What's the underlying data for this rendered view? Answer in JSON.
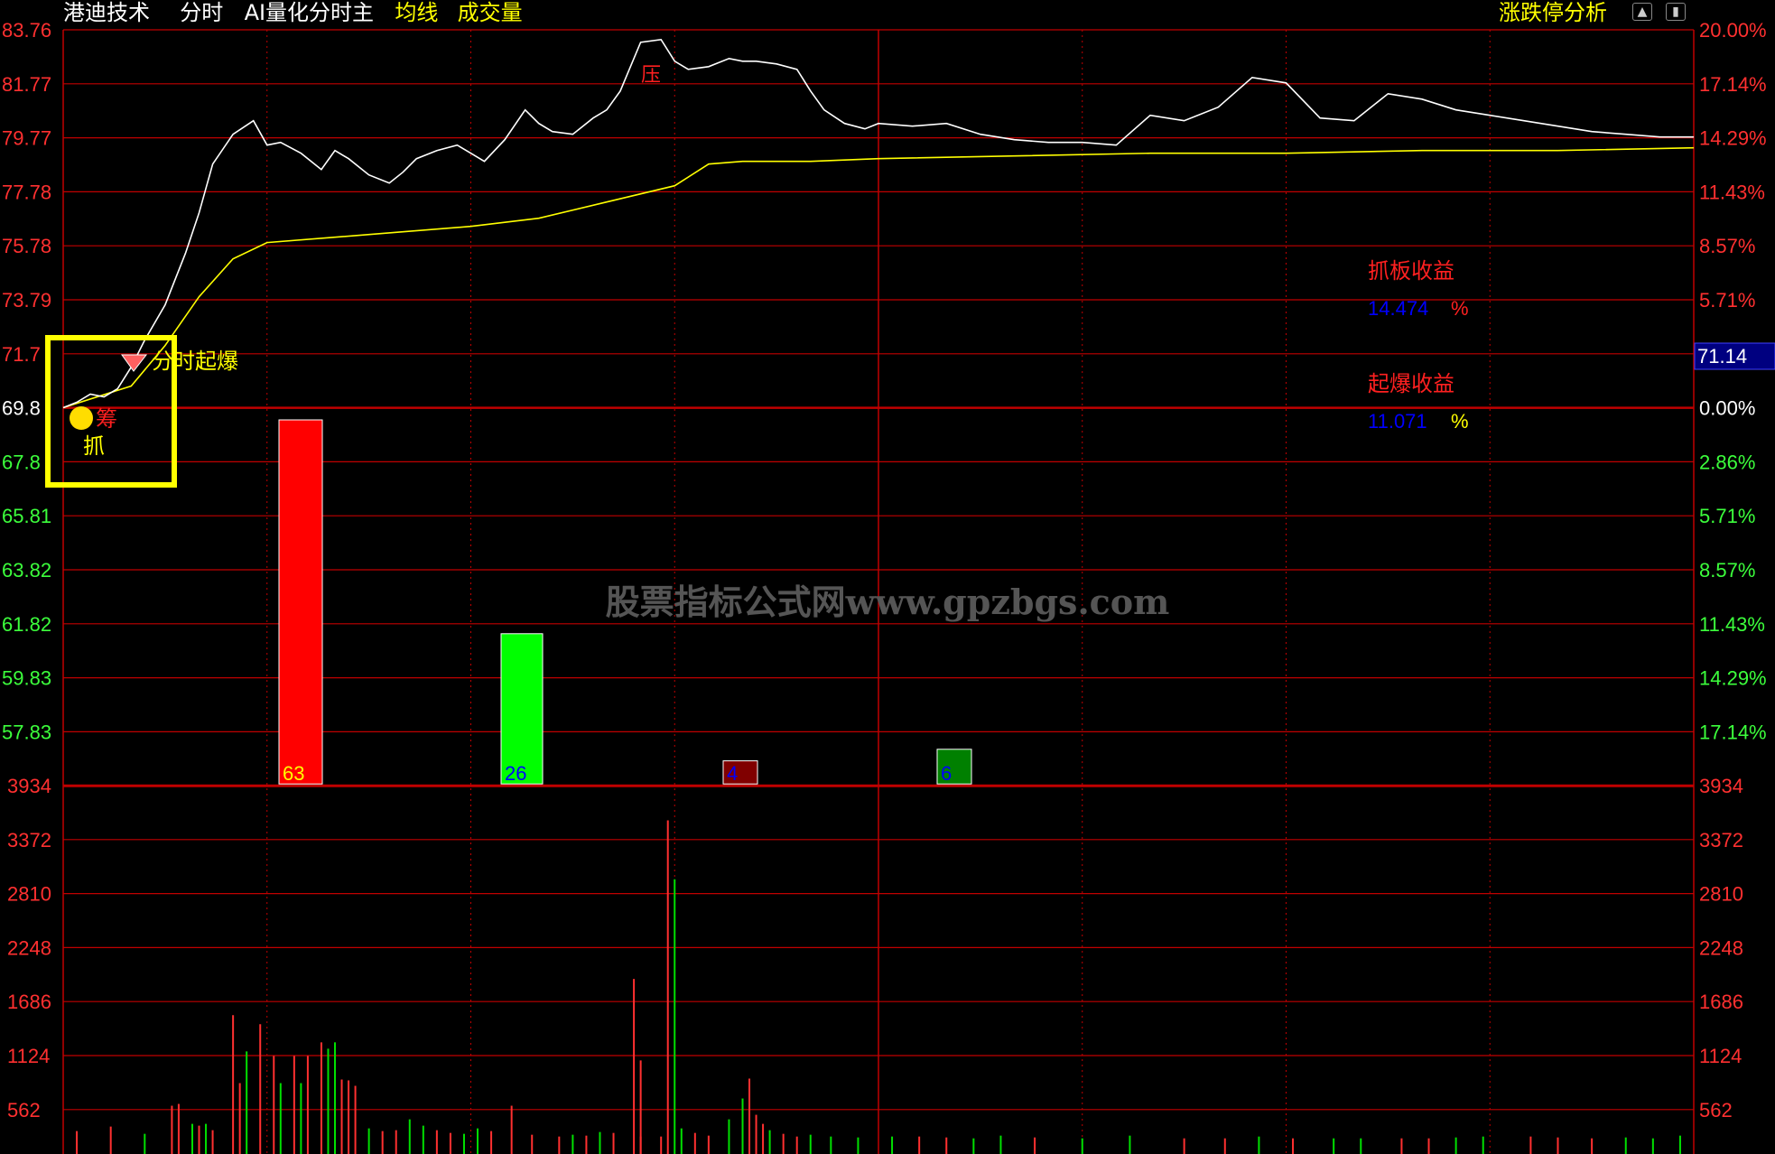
{
  "header": {
    "stock_name": "港迪技术",
    "view_label": "分时",
    "indicator_name": "AI量化分时主",
    "avg_line_label": "均线",
    "volume_label": "成交量",
    "limit_analysis_label": "涨跌停分析"
  },
  "colors": {
    "background": "#000000",
    "grid": "#c00000",
    "price_line": "#ffffff",
    "avg_line": "#ffff00",
    "axis_up": "#ff3030",
    "axis_down": "#3cff3c",
    "axis_flat": "#ffffff",
    "accent_yellow": "#ffff00",
    "current_price_box": "#000080"
  },
  "chart_data": {
    "type": "line",
    "title": "",
    "prev_close": 69.8,
    "price_axis_left": [
      "83.76",
      "81.77",
      "79.77",
      "77.78",
      "75.78",
      "73.79",
      "71.7",
      "69.8",
      "67.8",
      "65.81",
      "63.82",
      "61.82",
      "59.83",
      "57.83"
    ],
    "price_axis_right": [
      "20.00%",
      "17.14%",
      "14.29%",
      "11.43%",
      "8.57%",
      "5.71%",
      "",
      "0.00%",
      "2.86%",
      "5.71%",
      "8.57%",
      "11.43%",
      "14.29%",
      "17.14%"
    ],
    "current_price": "71.14",
    "ylim": [
      57.83,
      83.76
    ],
    "series": [
      {
        "name": "",
        "x": [
          0,
          2,
          4,
          6,
          8,
          10,
          12,
          15,
          18,
          20,
          22,
          25,
          28,
          30,
          32,
          35,
          38,
          40,
          42,
          45,
          48,
          50,
          52,
          55,
          58,
          60,
          62,
          65,
          68,
          70,
          72,
          75,
          78,
          80,
          82,
          85,
          88,
          90,
          92,
          95,
          98,
          100,
          102,
          105,
          108,
          110,
          112,
          115,
          118,
          120,
          125,
          130,
          135,
          140,
          145,
          150,
          155,
          160,
          165,
          170,
          175,
          180,
          185,
          190,
          195,
          200,
          205,
          210,
          215,
          220,
          225,
          230,
          235,
          240
        ],
        "values": [
          69.8,
          70.0,
          70.3,
          70.2,
          70.5,
          71.3,
          72.3,
          73.6,
          75.5,
          77.0,
          78.8,
          79.9,
          80.4,
          79.5,
          79.6,
          79.2,
          78.6,
          79.3,
          79.0,
          78.4,
          78.1,
          78.5,
          79.0,
          79.3,
          79.5,
          79.2,
          78.9,
          79.7,
          80.8,
          80.3,
          80.0,
          79.9,
          80.5,
          80.8,
          81.5,
          83.3,
          83.4,
          82.6,
          82.3,
          82.4,
          82.7,
          82.6,
          82.6,
          82.5,
          82.3,
          81.5,
          80.8,
          80.3,
          80.1,
          80.3,
          80.2,
          80.3,
          79.9,
          79.7,
          79.6,
          79.6,
          79.5,
          80.6,
          80.4,
          80.9,
          82.0,
          81.8,
          80.5,
          80.4,
          81.4,
          81.2,
          80.8,
          80.6,
          80.4,
          80.2,
          80.0,
          79.9,
          79.8,
          79.8
        ]
      },
      {
        "name": "",
        "x": [
          0,
          10,
          15,
          20,
          25,
          30,
          40,
          50,
          60,
          70,
          80,
          90,
          95,
          100,
          110,
          120,
          140,
          160,
          180,
          200,
          220,
          240
        ],
        "values": [
          69.8,
          70.6,
          72.1,
          73.9,
          75.3,
          75.9,
          76.1,
          76.3,
          76.5,
          76.8,
          77.4,
          78.0,
          78.8,
          78.9,
          78.9,
          79.0,
          79.1,
          79.2,
          79.2,
          79.3,
          79.3,
          79.4
        ]
      }
    ],
    "signals": [
      {
        "label": "筹",
        "color": "#ff2020"
      },
      {
        "label": "抓",
        "color": "#ffff00"
      },
      {
        "label": "分时起爆",
        "color": "#ffff00"
      },
      {
        "label": "压",
        "color": "#ff2020"
      }
    ],
    "stats": [
      {
        "label": "抓板收益",
        "value": "14.474",
        "unit": "%"
      },
      {
        "label": "起爆收益",
        "value": "11.071",
        "unit": "%"
      }
    ],
    "bars": [
      {
        "value": 63,
        "label": "63",
        "color": "#ff0000",
        "label_color": "#ffff00"
      },
      {
        "value": 26,
        "label": "26",
        "color": "#00ff00",
        "label_color": "#0000ff"
      },
      {
        "value": 4,
        "label": "4",
        "color": "#800000",
        "label_color": "#0000ff"
      },
      {
        "value": 6,
        "label": "6",
        "color": "#008000",
        "label_color": "#0000ff"
      }
    ],
    "volume": {
      "axis_labels": [
        "3934",
        "3372",
        "2810",
        "2248",
        "1686",
        "1124",
        "562"
      ],
      "ylim": [
        0,
        3934
      ],
      "bars": [
        [
          2,
          120,
          "up"
        ],
        [
          7,
          170,
          "up"
        ],
        [
          12,
          90,
          "dn"
        ],
        [
          16,
          400,
          "up"
        ],
        [
          17,
          420,
          "up"
        ],
        [
          19,
          200,
          "dn"
        ],
        [
          20,
          180,
          "up"
        ],
        [
          21,
          200,
          "dn"
        ],
        [
          22,
          130,
          "up"
        ],
        [
          25,
          1400,
          "up"
        ],
        [
          26,
          650,
          "up"
        ],
        [
          27,
          1000,
          "dn"
        ],
        [
          29,
          1300,
          "up"
        ],
        [
          31,
          950,
          "up"
        ],
        [
          32,
          650,
          "dn"
        ],
        [
          34,
          950,
          "up"
        ],
        [
          35,
          650,
          "dn"
        ],
        [
          36,
          950,
          "up"
        ],
        [
          38,
          1100,
          "up"
        ],
        [
          39,
          1030,
          "dn"
        ],
        [
          40,
          1100,
          "dn"
        ],
        [
          41,
          690,
          "up"
        ],
        [
          42,
          680,
          "up"
        ],
        [
          43,
          620,
          "up"
        ],
        [
          45,
          150,
          "dn"
        ],
        [
          47,
          120,
          "up"
        ],
        [
          49,
          130,
          "up"
        ],
        [
          51,
          250,
          "dn"
        ],
        [
          53,
          180,
          "dn"
        ],
        [
          55,
          130,
          "up"
        ],
        [
          57,
          100,
          "up"
        ],
        [
          59,
          90,
          "dn"
        ],
        [
          61,
          150,
          "dn"
        ],
        [
          63,
          120,
          "up"
        ],
        [
          66,
          400,
          "up"
        ],
        [
          69,
          80,
          "up"
        ],
        [
          73,
          60,
          "up"
        ],
        [
          75,
          80,
          "dn"
        ],
        [
          77,
          70,
          "up"
        ],
        [
          79,
          110,
          "dn"
        ],
        [
          81,
          100,
          "up"
        ],
        [
          85,
          60,
          "up"
        ],
        [
          88,
          60,
          "up"
        ],
        [
          91,
          150,
          "dn"
        ],
        [
          93,
          100,
          "up"
        ],
        [
          95,
          70,
          "up"
        ],
        [
          98,
          250,
          "dn"
        ],
        [
          100,
          480,
          "dn"
        ],
        [
          101,
          700,
          "up"
        ],
        [
          102,
          300,
          "up"
        ],
        [
          103,
          200,
          "up"
        ],
        [
          104,
          130,
          "dn"
        ],
        [
          106,
          90,
          "up"
        ],
        [
          108,
          60,
          "up"
        ],
        [
          110,
          80,
          "dn"
        ],
        [
          113,
          60,
          "dn"
        ],
        [
          117,
          50,
          "dn"
        ],
        [
          122,
          60,
          "dn"
        ],
        [
          126,
          60,
          "up"
        ],
        [
          130,
          50,
          "up"
        ],
        [
          134,
          40,
          "dn"
        ],
        [
          138,
          70,
          "dn"
        ],
        [
          143,
          50,
          "up"
        ],
        [
          150,
          40,
          "dn"
        ],
        [
          157,
          70,
          "dn"
        ],
        [
          165,
          40,
          "up"
        ],
        [
          171,
          40,
          "up"
        ],
        [
          176,
          60,
          "dn"
        ],
        [
          181,
          40,
          "up"
        ],
        [
          187,
          40,
          "dn"
        ],
        [
          191,
          40,
          "dn"
        ],
        [
          197,
          40,
          "up"
        ],
        [
          201,
          40,
          "up"
        ],
        [
          205,
          50,
          "dn"
        ],
        [
          209,
          60,
          "dn"
        ],
        [
          216,
          60,
          "up"
        ],
        [
          220,
          50,
          "up"
        ],
        [
          225,
          40,
          "up"
        ],
        [
          230,
          50,
          "dn"
        ],
        [
          234,
          40,
          "dn"
        ],
        [
          238,
          70,
          "dn"
        ]
      ],
      "spike_bars": [
        [
          84,
          1800,
          "up"
        ],
        [
          85,
          900,
          "up"
        ],
        [
          89,
          3550,
          "up"
        ],
        [
          90,
          2900,
          "dn"
        ]
      ]
    },
    "watermark": "股票指标公式网www.gpzbgs.com"
  }
}
